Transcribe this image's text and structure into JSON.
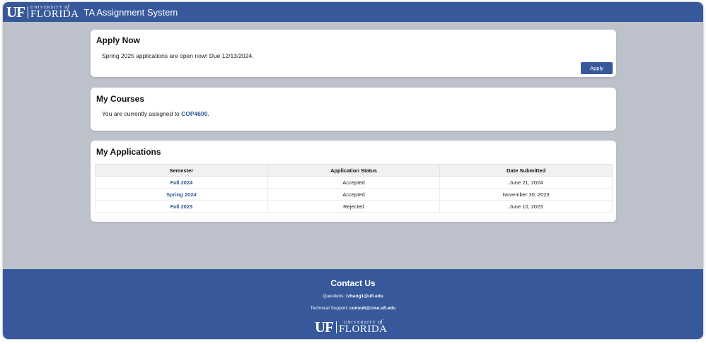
{
  "header": {
    "logo": {
      "uf": "UF",
      "university": "UNIVERSITY",
      "of": "of",
      "florida": "FLORIDA"
    },
    "title": "TA Assignment System"
  },
  "apply_card": {
    "heading": "Apply Now",
    "message": "Spring 2025 applications are open now! Due 12/13/2024.",
    "button_label": "Apply"
  },
  "courses_card": {
    "heading": "My Courses",
    "message_prefix": "You are currently assigned to ",
    "course": "COP4600",
    "message_suffix": "."
  },
  "applications_card": {
    "heading": "My Applications",
    "columns": [
      "Semester",
      "Application Status",
      "Date Submitted"
    ],
    "rows": [
      {
        "semester": "Fall 2024",
        "status": "Accepted",
        "date": "June 21, 2024"
      },
      {
        "semester": "Spring 2024",
        "status": "Accepted",
        "date": "November 30, 2023"
      },
      {
        "semester": "Fall 2023",
        "status": "Rejected",
        "date": "June 10, 2023"
      }
    ]
  },
  "footer": {
    "heading": "Contact Us",
    "questions_label": "Questions: ",
    "questions_email": "rzhang1@ufl.edu",
    "support_label": "Technical Support: ",
    "support_email": "consult@cise.ufl.edu",
    "logo": {
      "uf": "UF",
      "university": "UNIVERSITY",
      "of": "of",
      "florida": "FLORIDA"
    }
  },
  "colors": {
    "brand_blue": "#37599b",
    "link_blue": "#2d5a9c",
    "page_background": "#bdc1cb"
  }
}
